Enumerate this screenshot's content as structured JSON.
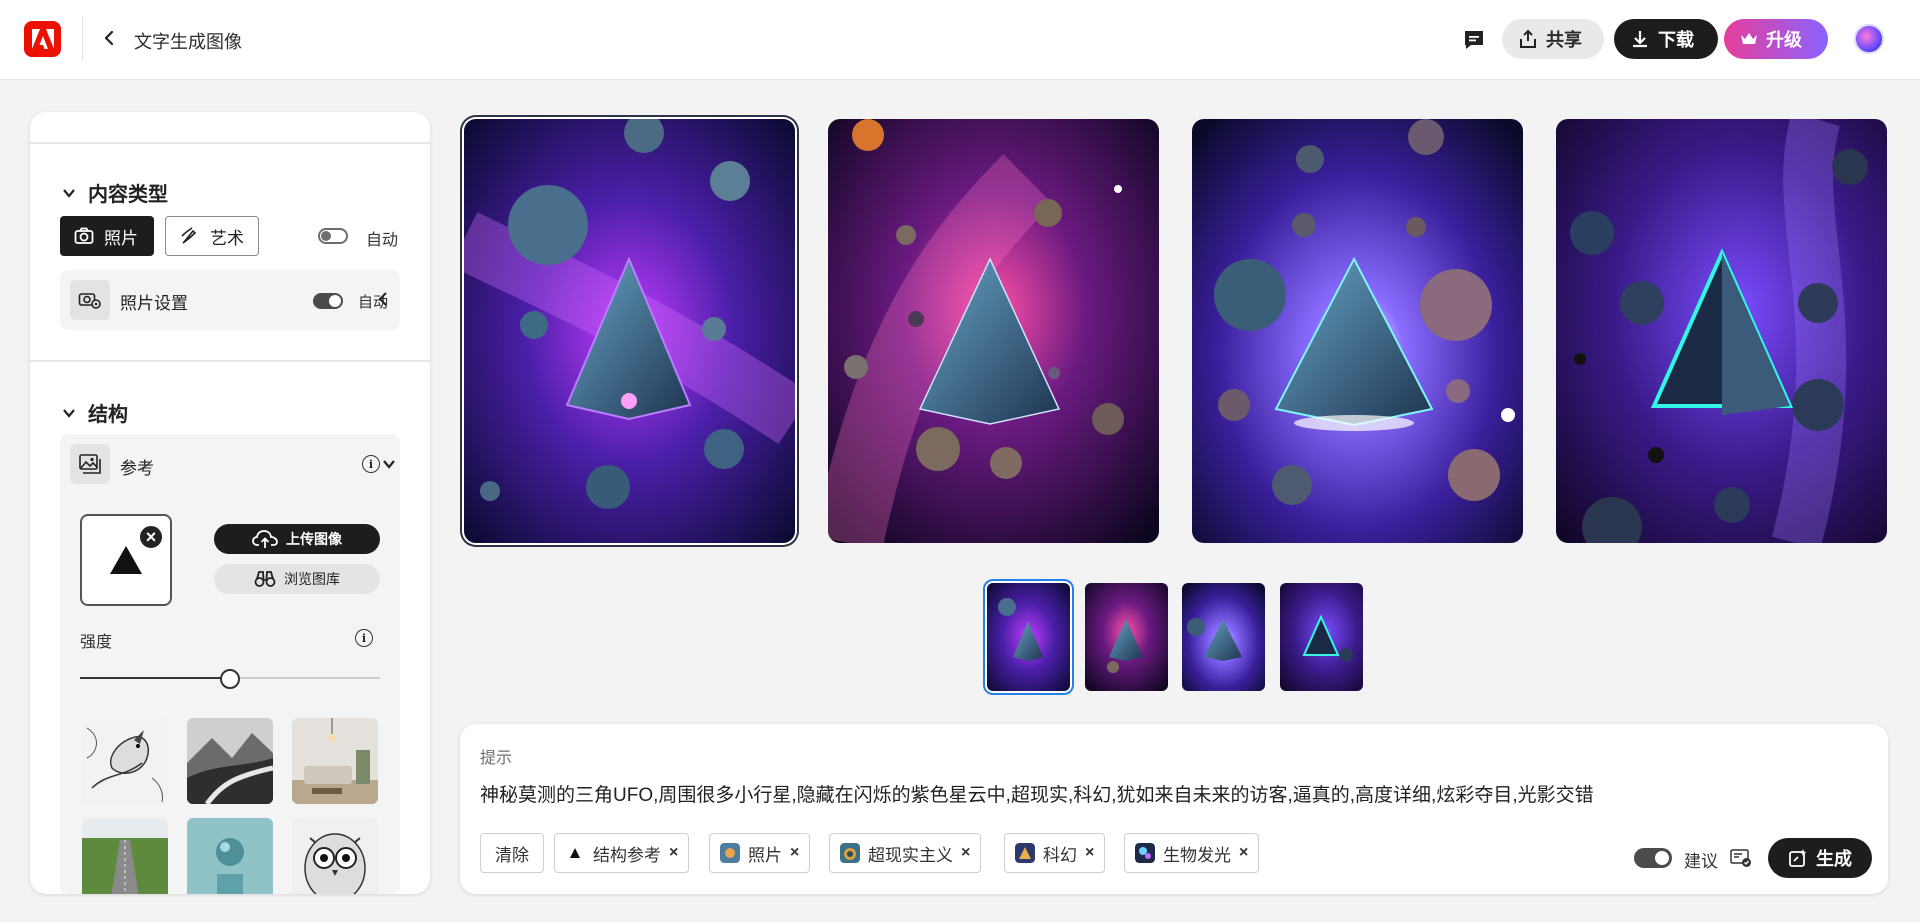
{
  "header": {
    "title": "文字生成图像",
    "share_label": "共享",
    "download_label": "下载",
    "upgrade_label": "升级",
    "colors": {
      "brand": "#eb1000",
      "upgrade_start": "#e63e9b",
      "upgrade_end": "#8b63ff"
    }
  },
  "sidebar": {
    "content_type": {
      "title": "内容类型",
      "photo_label": "照片",
      "art_label": "艺术",
      "auto_label": "自动",
      "photo_settings_label": "照片设置",
      "photo_settings_auto_label": "自动"
    },
    "structure": {
      "title": "结构",
      "reference_label": "参考",
      "upload_label": "上传图像",
      "browse_label": "浏览图库",
      "strength_label": "强度",
      "strength_value": 0.5
    }
  },
  "gallery": {
    "selected_index": 0,
    "images": [
      "variation-1",
      "variation-2",
      "variation-3",
      "variation-4"
    ]
  },
  "prompt": {
    "label": "提示",
    "text": "神秘莫测的三角UFO,周围很多小行星,隐藏在闪烁的紫色星云中,超现实,科幻,犹如来自未来的访客,逼真的,高度详细,炫彩夺目,光影交错",
    "clear_label": "清除",
    "chips": [
      {
        "label": "结构参考"
      },
      {
        "label": "照片"
      },
      {
        "label": "超现实主义"
      },
      {
        "label": "科幻"
      },
      {
        "label": "生物发光"
      }
    ],
    "suggest_label": "建议",
    "generate_label": "生成"
  }
}
